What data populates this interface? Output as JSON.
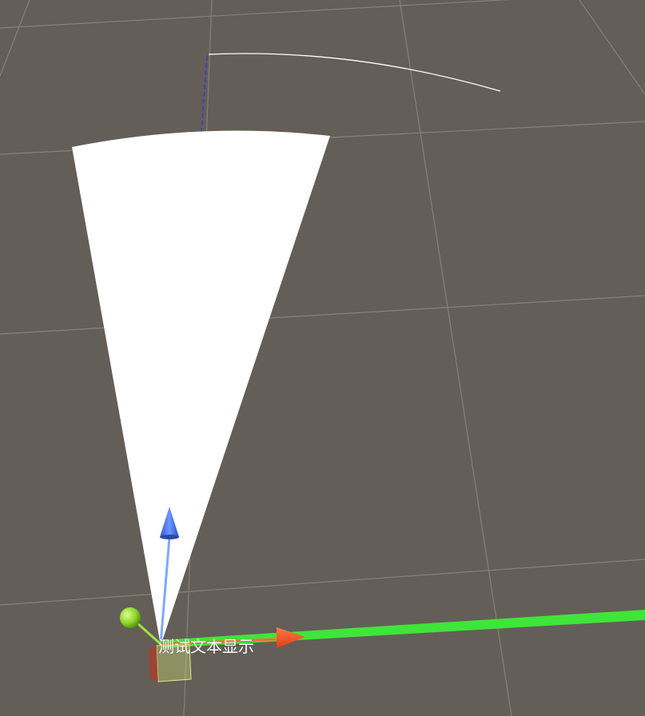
{
  "scene": {
    "background_color": "#645e58",
    "grid_color": "#8c8782",
    "sector_color": "#ffffff",
    "arc_line_color": "#ffffff",
    "forward_line_color": "#3b3bd6",
    "label": {
      "text": "测试文本显示",
      "color": "#ffffff"
    }
  },
  "gizmo": {
    "type": "move-tool",
    "x_axis": {
      "color": "#ff4a1c",
      "icon": "x-axis-arrow-icon"
    },
    "y_axis": {
      "color": "#3fe53a",
      "icon": "y-axis-line-icon"
    },
    "z_axis": {
      "color": "#4d7fff",
      "icon": "z-axis-arrow-icon"
    },
    "free_move_handle": {
      "color": "#9ee43a",
      "icon": "free-move-sphere-icon"
    },
    "plane_handle": {
      "color": "#d8ef78",
      "icon": "plane-handle-icon"
    }
  }
}
